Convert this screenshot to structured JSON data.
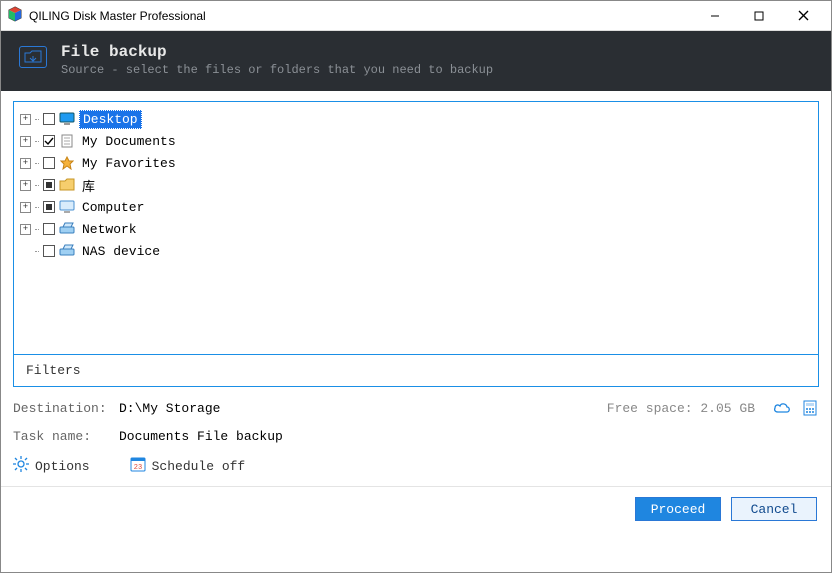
{
  "titlebar": {
    "title": "QILING Disk Master Professional"
  },
  "header": {
    "title": "File backup",
    "subtitle": "Source - select the files or folders that you need to backup"
  },
  "tree": {
    "items": [
      {
        "label": "Desktop"
      },
      {
        "label": "My Documents"
      },
      {
        "label": "My Favorites"
      },
      {
        "label": "库"
      },
      {
        "label": "Computer"
      },
      {
        "label": "Network"
      },
      {
        "label": "NAS device"
      }
    ]
  },
  "filters": {
    "label": "Filters"
  },
  "destination": {
    "label": "Destination:",
    "value": "D:\\My Storage",
    "free_label": "Free space: 2.05 GB"
  },
  "task": {
    "label": "Task name:",
    "value": "Documents File backup"
  },
  "options": {
    "options_label": "Options",
    "schedule_label": "Schedule off"
  },
  "footer": {
    "proceed": "Proceed",
    "cancel": "Cancel"
  }
}
